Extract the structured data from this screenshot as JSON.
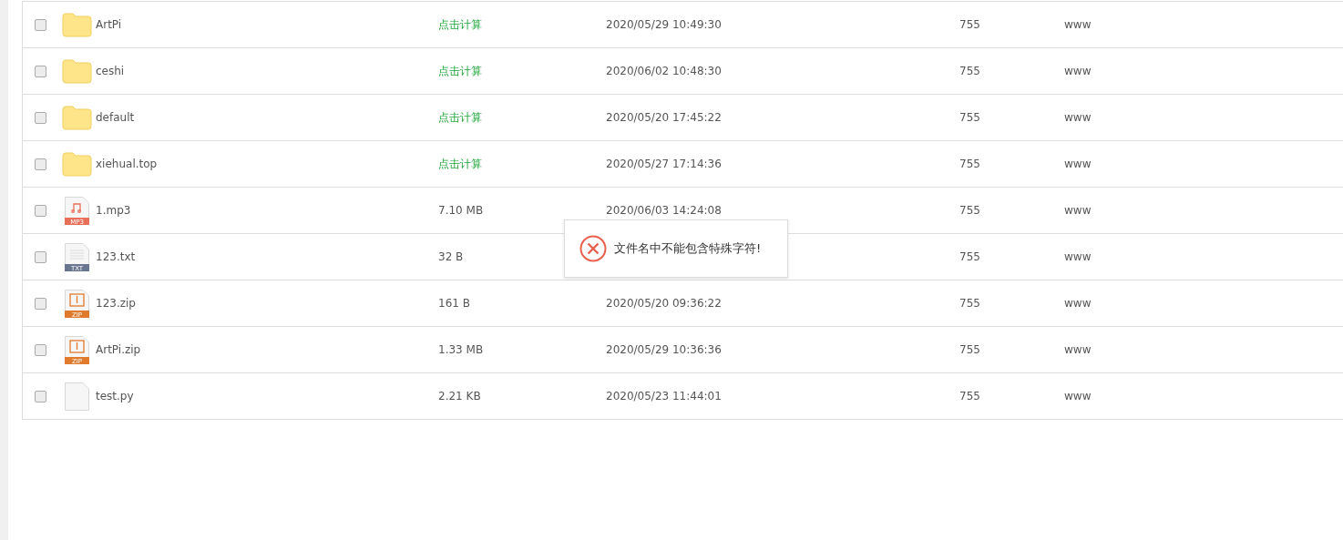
{
  "files": [
    {
      "kind": "folder",
      "name": "ArtPi",
      "size": "点击计算",
      "date": "2020/05/29 10:49:30",
      "permission": "755",
      "owner": "www",
      "checked": false
    },
    {
      "kind": "folder",
      "name": "ceshi",
      "size": "点击计算",
      "date": "2020/06/02 10:48:30",
      "permission": "755",
      "owner": "www",
      "checked": false
    },
    {
      "kind": "folder",
      "name": "default",
      "size": "点击计算",
      "date": "2020/05/20 17:45:22",
      "permission": "755",
      "owner": "www",
      "checked": false
    },
    {
      "kind": "folder",
      "name": "xiehual.top",
      "size": "点击计算",
      "date": "2020/05/27 17:14:36",
      "permission": "755",
      "owner": "www",
      "checked": false
    },
    {
      "kind": "mp3",
      "badge": "MP3",
      "name": "1.mp3",
      "size": "7.10 MB",
      "date": "2020/06/03 14:24:08",
      "permission": "755",
      "owner": "www",
      "checked": false
    },
    {
      "kind": "txt",
      "badge": "TXT",
      "name": "123.txt",
      "size": "32 B",
      "permission": "755",
      "owner": "www",
      "checked": false
    },
    {
      "kind": "zip",
      "badge": "ZIP",
      "name": "123.zip",
      "size": "161 B",
      "date": "2020/05/20 09:36:22",
      "permission": "755",
      "owner": "www",
      "checked": false
    },
    {
      "kind": "zip",
      "badge": "ZIP",
      "name": "ArtPi.zip",
      "size": "1.33 MB",
      "date": "2020/05/29 10:36:36",
      "permission": "755",
      "owner": "www",
      "checked": false
    },
    {
      "kind": "file",
      "name": "test.py",
      "size": "2.21 KB",
      "date": "2020/05/23 11:44:01",
      "permission": "755",
      "owner": "www",
      "checked": false
    }
  ],
  "toast": {
    "message": "文件名中不能包含特殊字符!"
  }
}
